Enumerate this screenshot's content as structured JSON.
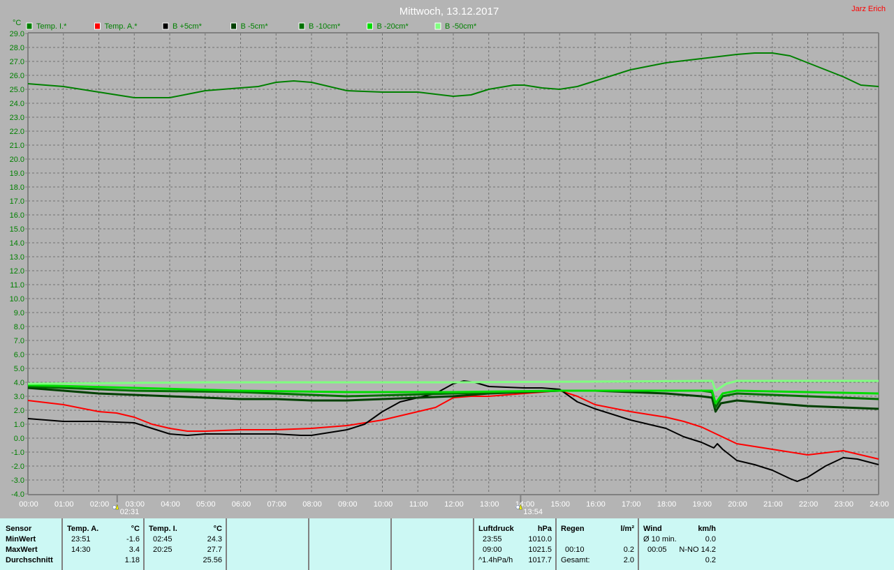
{
  "chart_data": {
    "type": "line",
    "title": "Mittwoch, 13.12.2017",
    "author": "Jarz Erich",
    "ylabel": "°C",
    "xlabel": "",
    "ylim": [
      -4,
      29
    ],
    "xlim": [
      0,
      24
    ],
    "grid": true,
    "legend_position": "top",
    "x_ticks": [
      "00:00",
      "01:00",
      "02:00",
      "03:00",
      "04:00",
      "05:00",
      "06:00",
      "07:00",
      "08:00",
      "09:00",
      "10:00",
      "11:00",
      "12:00",
      "13:00",
      "14:00",
      "15:00",
      "16:00",
      "17:00",
      "18:00",
      "19:00",
      "20:00",
      "21:00",
      "22:00",
      "23:00",
      "24:00"
    ],
    "y_ticks": [
      "29.0",
      "28.0",
      "27.0",
      "26.0",
      "25.0",
      "24.0",
      "23.0",
      "22.0",
      "21.0",
      "20.0",
      "19.0",
      "18.0",
      "17.0",
      "16.0",
      "15.0",
      "14.0",
      "13.0",
      "12.0",
      "11.0",
      "10.0",
      "9.0",
      "8.0",
      "7.0",
      "6.0",
      "5.0",
      "4.0",
      "3.0",
      "2.0",
      "1.0",
      "0.0",
      "-1.0",
      "-2.0",
      "-3.0",
      "-4.0"
    ],
    "annotations": [
      {
        "time": 2.517,
        "label": "02:31",
        "icon": "moon-icon"
      },
      {
        "time": 13.9,
        "label": "13:54",
        "icon": "sun-icon"
      }
    ],
    "series": [
      {
        "name": "Temp. I.*",
        "color": "#008000",
        "points": [
          [
            0,
            25.4
          ],
          [
            1,
            25.2
          ],
          [
            2,
            24.8
          ],
          [
            2.5,
            24.6
          ],
          [
            3,
            24.4
          ],
          [
            4,
            24.4
          ],
          [
            5,
            24.9
          ],
          [
            6,
            25.1
          ],
          [
            6.5,
            25.2
          ],
          [
            7,
            25.5
          ],
          [
            7.5,
            25.6
          ],
          [
            8,
            25.5
          ],
          [
            9,
            24.9
          ],
          [
            10,
            24.8
          ],
          [
            11,
            24.8
          ],
          [
            12,
            24.5
          ],
          [
            12.5,
            24.6
          ],
          [
            13,
            25.0
          ],
          [
            13.7,
            25.3
          ],
          [
            14,
            25.3
          ],
          [
            14.5,
            25.1
          ],
          [
            15,
            25.0
          ],
          [
            15.5,
            25.2
          ],
          [
            16,
            25.6
          ],
          [
            17,
            26.4
          ],
          [
            18,
            26.9
          ],
          [
            19,
            27.2
          ],
          [
            20,
            27.5
          ],
          [
            20.5,
            27.6
          ],
          [
            21,
            27.6
          ],
          [
            21.5,
            27.4
          ],
          [
            22,
            26.9
          ],
          [
            23,
            25.9
          ],
          [
            23.5,
            25.3
          ],
          [
            24,
            25.2
          ]
        ]
      },
      {
        "name": "Temp. A.*",
        "color": "#ff0000",
        "points": [
          [
            0,
            2.7
          ],
          [
            1,
            2.4
          ],
          [
            2,
            1.9
          ],
          [
            2.5,
            1.8
          ],
          [
            3,
            1.5
          ],
          [
            3.5,
            1.0
          ],
          [
            4,
            0.7
          ],
          [
            4.5,
            0.5
          ],
          [
            5,
            0.5
          ],
          [
            6,
            0.6
          ],
          [
            7,
            0.6
          ],
          [
            8,
            0.7
          ],
          [
            9,
            0.9
          ],
          [
            10,
            1.3
          ],
          [
            11,
            1.9
          ],
          [
            11.5,
            2.2
          ],
          [
            12,
            2.9
          ],
          [
            12.5,
            3.0
          ],
          [
            13,
            3.0
          ],
          [
            14,
            3.2
          ],
          [
            15,
            3.4
          ],
          [
            15.5,
            3.0
          ],
          [
            16,
            2.4
          ],
          [
            17,
            1.9
          ],
          [
            18,
            1.5
          ],
          [
            18.5,
            1.2
          ],
          [
            19,
            0.8
          ],
          [
            19.5,
            0.2
          ],
          [
            20,
            -0.4
          ],
          [
            21,
            -0.8
          ],
          [
            22,
            -1.2
          ],
          [
            23,
            -0.9
          ],
          [
            23.5,
            -1.2
          ],
          [
            24,
            -1.5
          ]
        ]
      },
      {
        "name": "B +5cm*",
        "color": "#000000",
        "points": [
          [
            0,
            1.4
          ],
          [
            0.5,
            1.3
          ],
          [
            1,
            1.2
          ],
          [
            2,
            1.2
          ],
          [
            3,
            1.1
          ],
          [
            3.5,
            0.7
          ],
          [
            4,
            0.3
          ],
          [
            4.5,
            0.2
          ],
          [
            5,
            0.3
          ],
          [
            6,
            0.3
          ],
          [
            7,
            0.3
          ],
          [
            7.7,
            0.2
          ],
          [
            8,
            0.2
          ],
          [
            9,
            0.6
          ],
          [
            9.5,
            1.0
          ],
          [
            10,
            1.9
          ],
          [
            10.5,
            2.6
          ],
          [
            11,
            2.9
          ],
          [
            11.5,
            3.2
          ],
          [
            12,
            3.9
          ],
          [
            12.3,
            4.1
          ],
          [
            12.6,
            4.0
          ],
          [
            13,
            3.7
          ],
          [
            14,
            3.6
          ],
          [
            14.5,
            3.6
          ],
          [
            15,
            3.5
          ],
          [
            15.5,
            2.6
          ],
          [
            16,
            2.1
          ],
          [
            17,
            1.3
          ],
          [
            18,
            0.7
          ],
          [
            18.5,
            0.1
          ],
          [
            19,
            -0.3
          ],
          [
            19.35,
            -0.7
          ],
          [
            19.45,
            -0.4
          ],
          [
            19.6,
            -0.8
          ],
          [
            20,
            -1.6
          ],
          [
            20.5,
            -1.9
          ],
          [
            21,
            -2.3
          ],
          [
            21.5,
            -2.9
          ],
          [
            21.7,
            -3.1
          ],
          [
            22,
            -2.8
          ],
          [
            22.5,
            -2.0
          ],
          [
            23,
            -1.4
          ],
          [
            23.4,
            -1.5
          ],
          [
            24,
            -1.9
          ]
        ]
      },
      {
        "name": "B -5cm*",
        "color": "#004000",
        "points": [
          [
            0,
            3.6
          ],
          [
            1,
            3.4
          ],
          [
            2,
            3.2
          ],
          [
            3,
            3.1
          ],
          [
            4,
            3.0
          ],
          [
            5,
            2.9
          ],
          [
            6,
            2.8
          ],
          [
            7,
            2.8
          ],
          [
            8,
            2.7
          ],
          [
            9,
            2.7
          ],
          [
            10,
            2.8
          ],
          [
            11,
            2.9
          ],
          [
            12,
            3.0
          ],
          [
            13,
            3.2
          ],
          [
            14,
            3.3
          ],
          [
            15,
            3.4
          ],
          [
            16,
            3.4
          ],
          [
            17,
            3.3
          ],
          [
            18,
            3.2
          ],
          [
            19,
            3.0
          ],
          [
            19.3,
            2.9
          ],
          [
            19.4,
            1.9
          ],
          [
            19.55,
            2.5
          ],
          [
            20,
            2.7
          ],
          [
            21,
            2.5
          ],
          [
            22,
            2.3
          ],
          [
            23,
            2.2
          ],
          [
            24,
            2.1
          ]
        ]
      },
      {
        "name": "B -10cm*",
        "color": "#007000",
        "points": [
          [
            0,
            3.7
          ],
          [
            3,
            3.4
          ],
          [
            6,
            3.3
          ],
          [
            9,
            3.0
          ],
          [
            12,
            3.2
          ],
          [
            15,
            3.4
          ],
          [
            19,
            3.4
          ],
          [
            19.3,
            3.3
          ],
          [
            19.4,
            2.2
          ],
          [
            19.6,
            3.0
          ],
          [
            20,
            3.2
          ],
          [
            22,
            3.0
          ],
          [
            24,
            2.8
          ]
        ]
      },
      {
        "name": "B -20cm*",
        "color": "#00dd00",
        "points": [
          [
            0,
            3.8
          ],
          [
            3,
            3.6
          ],
          [
            6,
            3.4
          ],
          [
            9,
            3.3
          ],
          [
            12,
            3.3
          ],
          [
            15,
            3.4
          ],
          [
            19,
            3.4
          ],
          [
            19.3,
            3.4
          ],
          [
            19.4,
            2.5
          ],
          [
            19.6,
            3.2
          ],
          [
            20,
            3.4
          ],
          [
            22,
            3.3
          ],
          [
            24,
            3.2
          ]
        ]
      },
      {
        "name": "B -50cm*",
        "color": "#80ff80",
        "points": [
          [
            0,
            3.9
          ],
          [
            5,
            4.0
          ],
          [
            12,
            4.0
          ],
          [
            19.3,
            4.1
          ],
          [
            19.4,
            3.4
          ],
          [
            19.7,
            3.9
          ],
          [
            20,
            4.1
          ],
          [
            24,
            4.1
          ]
        ]
      }
    ]
  },
  "table": {
    "temp": {
      "sensor": "Sensor",
      "min": "MinWert",
      "max": "MaxWert",
      "avg": "Durchschnitt",
      "a_head": "Temp. A.",
      "a_unit": "°C",
      "a_min_t": "23:51",
      "a_min": "-1.6",
      "a_max_t": "14:30",
      "a_max": "3.4",
      "a_avg": "1.18",
      "i_head": "Temp. I.",
      "i_unit": "°C",
      "i_min_t": "02:45",
      "i_min": "24.3",
      "i_max_t": "20:25",
      "i_max": "27.7",
      "i_avg": "25.56"
    },
    "pressure": {
      "head": "Luftdruck",
      "unit": "hPa",
      "min_t": "23:55",
      "min": "1010.0",
      "max_t": "09:00",
      "max": "1021.5",
      "trend": "^1.4hPa/h",
      "avg": "1017.7"
    },
    "rain": {
      "head": "Regen",
      "unit": "l/m²",
      "max_t": "00:10",
      "max": "0.2",
      "total_label": "Gesamt:",
      "total": "2.0"
    },
    "wind": {
      "head": "Wind",
      "unit": "km/h",
      "avg_label": "Ø 10 min.",
      "avg": "0.0",
      "max_t": "00:05",
      "max": "N-NO 14.2",
      "mean": "0.2"
    }
  }
}
